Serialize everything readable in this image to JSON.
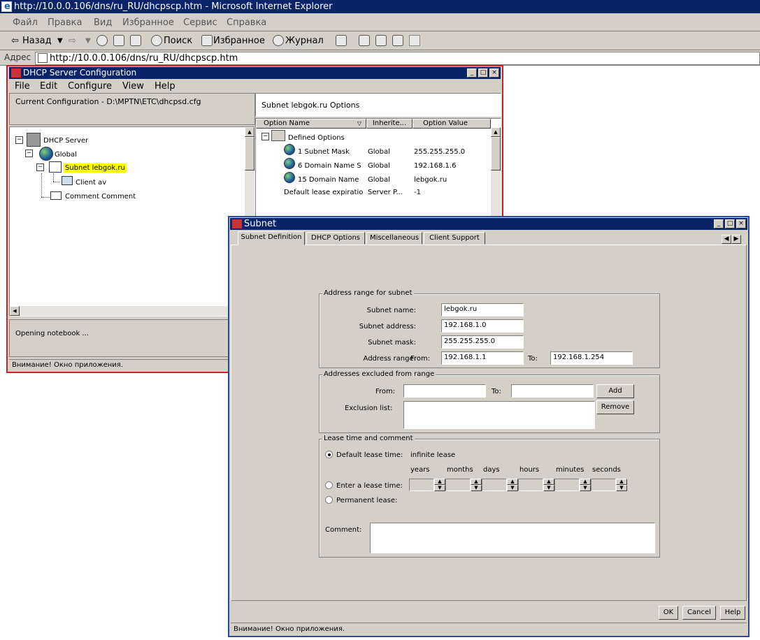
{
  "ie": {
    "title": "http://10.0.0.106/dns/ru_RU/dhcpscp.htm - Microsoft Internet Explorer",
    "menu": [
      "Файл",
      "Правка",
      "Вид",
      "Избранное",
      "Сервис",
      "Справка"
    ],
    "back": "Назад",
    "search": "Поиск",
    "favorites": "Избранное",
    "history": "Журнал",
    "address_label": "Адрес",
    "address": "http://10.0.0.106/dns/ru_RU/dhcpscp.htm"
  },
  "dhcp": {
    "title": "DHCP Server Configuration",
    "menu": [
      "File",
      "Edit",
      "Configure",
      "View",
      "Help"
    ],
    "current_config": "Current Configuration - D:\\MPTN\\ETC\\dhcpsd.cfg",
    "tree": {
      "server": "DHCP Server",
      "global": "Global",
      "subnet": "Subnet lebgok.ru",
      "client": "Client av",
      "comment": "Comment Comment"
    },
    "options_title": "Subnet lebgok.ru Options",
    "columns": [
      "Option Name",
      "Inherite...",
      "Option Value"
    ],
    "defined_options": "Defined Options",
    "rows": [
      {
        "name": "1 Subnet Mask",
        "inherited": "Global",
        "value": "255.255.255.0"
      },
      {
        "name": "6 Domain Name S",
        "inherited": "Global",
        "value": "192.168.1.6"
      },
      {
        "name": "15 Domain Name",
        "inherited": "Global",
        "value": "lebgok.ru"
      },
      {
        "name": "Default lease expiratio",
        "inherited": "Server P...",
        "value": "-1"
      }
    ],
    "status_msg": "Opening notebook ...",
    "warning": "Внимание! Окно приложения."
  },
  "subnet": {
    "title": "Subnet",
    "tabs": [
      "Subnet Definition",
      "DHCP Options",
      "Miscellaneous",
      "Client Support"
    ],
    "range_group": "Address range for subnet",
    "name_label": "Subnet name:",
    "name_value": "lebgok.ru",
    "address_label": "Subnet address:",
    "address_value": "192.168.1.0",
    "mask_label": "Subnet mask:",
    "mask_value": "255.255.255.0",
    "range_label": "Address range:",
    "from_label": "From:",
    "from_value": "192.168.1.1",
    "to_label": "To:",
    "to_value": "192.168.1.254",
    "excl_group": "Addresses excluded from range",
    "excl_from_label": "From:",
    "excl_to_label": "To:",
    "add": "Add",
    "exclusion_label": "Exclusion list:",
    "remove": "Remove",
    "lease_group": "Lease time and comment",
    "default_lease": "Default lease time:",
    "infinite": "infinite lease",
    "units": [
      "years",
      "months",
      "days",
      "hours",
      "minutes",
      "seconds"
    ],
    "enter_lease": "Enter a lease time:",
    "permanent": "Permanent lease:",
    "comment_label": "Comment:",
    "ok": "OK",
    "cancel": "Cancel",
    "help": "Help",
    "warning": "Внимание! Окно приложения."
  }
}
